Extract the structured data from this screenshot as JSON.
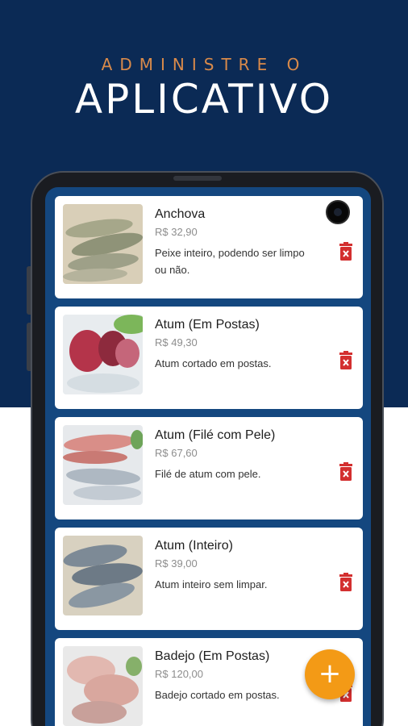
{
  "banner": {
    "tagline": "ADMINISTRE O",
    "headline": "APLICATIVO"
  },
  "colors": {
    "navy": "#0b2a55",
    "screen_blue": "#14477f",
    "accent_orange": "#f39a16",
    "delete_red": "#d32f2f"
  },
  "products": [
    {
      "name": "Anchova",
      "price": "R$ 32,90",
      "description": "Peixe inteiro, podendo ser limpo ou não."
    },
    {
      "name": "Atum (Em Postas)",
      "price": "R$ 49,30",
      "description": "Atum cortado em postas."
    },
    {
      "name": "Atum (Filé com Pele)",
      "price": "R$ 67,60",
      "description": "Filé de atum com pele."
    },
    {
      "name": "Atum (Inteiro)",
      "price": "R$ 39,00",
      "description": "Atum inteiro sem limpar."
    },
    {
      "name": "Badejo (Em Postas)",
      "price": "R$ 120,00",
      "description": "Badejo cortado em postas."
    }
  ],
  "icons": {
    "delete": "trash-icon",
    "add": "plus-icon"
  },
  "fab": {
    "label": "+"
  }
}
